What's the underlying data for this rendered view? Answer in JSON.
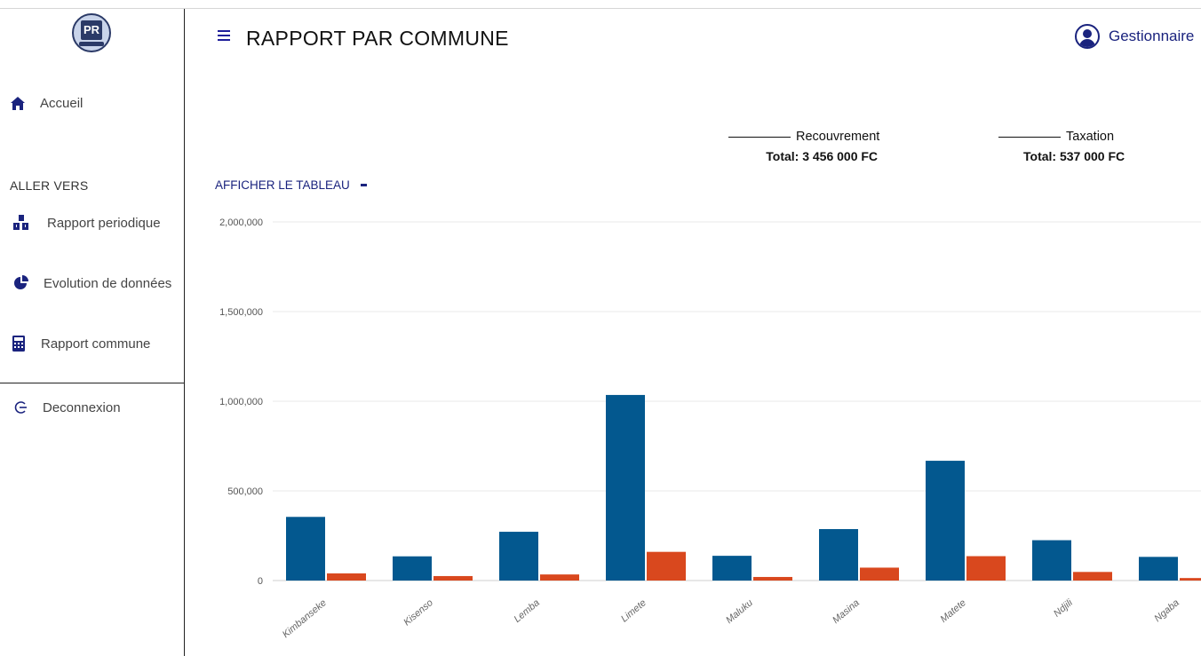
{
  "sidebar": {
    "logo_text": "PR",
    "home": "Accueil",
    "section_title": "ALLER VERS",
    "items": [
      {
        "label": "Rapport periodique",
        "icon": "boxes-icon"
      },
      {
        "label": "Evolution de données",
        "icon": "pie-chart-icon"
      },
      {
        "label": "Rapport commune",
        "icon": "calculator-icon"
      }
    ],
    "logout": "Deconnexion"
  },
  "header": {
    "title": "RAPPORT PAR COMMUNE",
    "user_name": "Gestionnaire"
  },
  "legend": {
    "recouvrement_label": "Recouvrement",
    "recouvrement_total": "Total: 3 456 000 FC",
    "taxation_label": "Taxation",
    "taxation_total": "Total: 537 000 FC"
  },
  "show_table_label": "AFFICHER LE TABLEAU",
  "colors": {
    "recouvrement": "#03588f",
    "taxation": "#d9481e",
    "accent": "#1a237e"
  },
  "chart_data": {
    "type": "bar",
    "categories": [
      "Kimbanseke",
      "Kisenso",
      "Lemba",
      "Limete",
      "Maluku",
      "Masina",
      "Matete",
      "Ndjili",
      "Ngaba"
    ],
    "series": [
      {
        "name": "Recouvrement",
        "values": [
          355000,
          135000,
          272000,
          1035000,
          138000,
          287000,
          668000,
          225000,
          132000
        ]
      },
      {
        "name": "Taxation",
        "values": [
          40000,
          25000,
          34000,
          160000,
          20000,
          72000,
          136000,
          48000,
          14000
        ]
      }
    ],
    "y_ticks": [
      "0",
      "500,000",
      "1,000,000",
      "1,500,000",
      "2,000,000"
    ],
    "ylim": [
      0,
      2000000
    ],
    "grid": true
  }
}
